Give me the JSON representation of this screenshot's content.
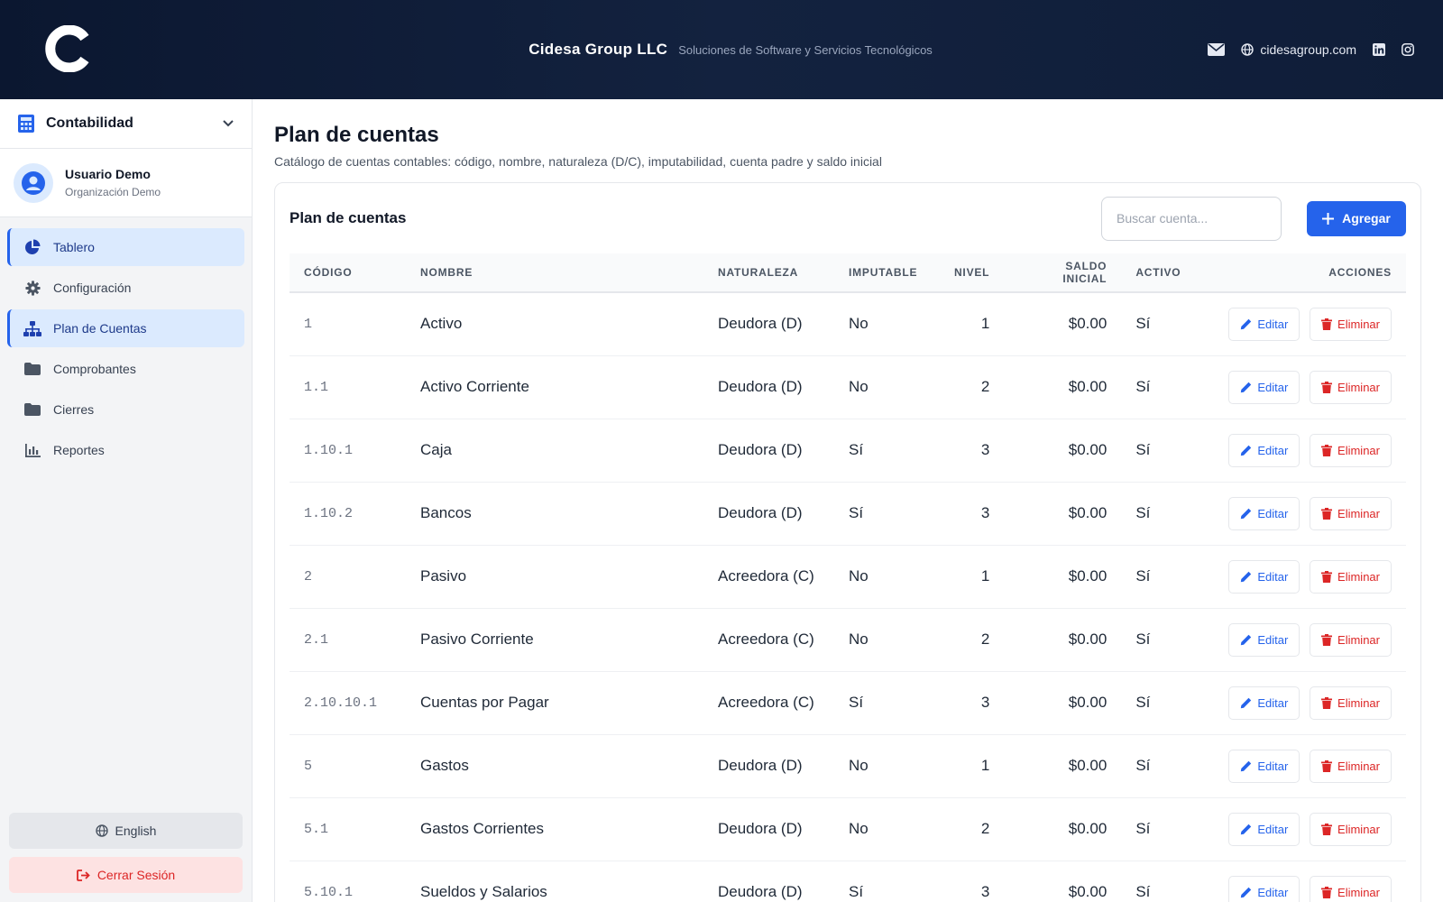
{
  "header": {
    "company": "Cidesa Group LLC",
    "tagline": "Soluciones de Software y Servicios Tecnológicos",
    "website": "cidesagroup.com",
    "colors": {
      "bg": "#0f1d38",
      "text": "#ffffff"
    }
  },
  "sidebar": {
    "module": "Contabilidad",
    "user": {
      "name": "Usuario Demo",
      "org": "Organización Demo"
    },
    "items": [
      {
        "label": "Tablero",
        "icon": "pie-chart-icon",
        "active": true
      },
      {
        "label": "Configuración",
        "icon": "gear-icon",
        "active": false
      },
      {
        "label": "Plan de Cuentas",
        "icon": "sitemap-icon",
        "active": true
      },
      {
        "label": "Comprobantes",
        "icon": "folder-icon",
        "active": false
      },
      {
        "label": "Cierres",
        "icon": "folder-icon",
        "active": false
      },
      {
        "label": "Reportes",
        "icon": "bar-chart-icon",
        "active": false
      }
    ],
    "language_label": "English",
    "logout_label": "Cerrar Sesión"
  },
  "main": {
    "title": "Plan de cuentas",
    "description": "Catálogo de cuentas contables: código, nombre, naturaleza (D/C), imputabilidad, cuenta padre y saldo inicial",
    "card_title": "Plan de cuentas",
    "search_placeholder": "Buscar cuenta...",
    "add_label": "Agregar",
    "edit_label": "Editar",
    "delete_label": "Eliminar",
    "columns": [
      "CÓDIGO",
      "NOMBRE",
      "NATURALEZA",
      "IMPUTABLE",
      "NIVEL",
      "SALDO INICIAL",
      "ACTIVO",
      "ACCIONES"
    ],
    "rows": [
      {
        "code": "1",
        "name": "Activo",
        "nature": "Deudora (D)",
        "imputable": "No",
        "level": "1",
        "balance": "$0.00",
        "active": "Sí"
      },
      {
        "code": "1.1",
        "name": "Activo Corriente",
        "nature": "Deudora (D)",
        "imputable": "No",
        "level": "2",
        "balance": "$0.00",
        "active": "Sí"
      },
      {
        "code": "1.10.1",
        "name": "Caja",
        "nature": "Deudora (D)",
        "imputable": "Sí",
        "level": "3",
        "balance": "$0.00",
        "active": "Sí"
      },
      {
        "code": "1.10.2",
        "name": "Bancos",
        "nature": "Deudora (D)",
        "imputable": "Sí",
        "level": "3",
        "balance": "$0.00",
        "active": "Sí"
      },
      {
        "code": "2",
        "name": "Pasivo",
        "nature": "Acreedora (C)",
        "imputable": "No",
        "level": "1",
        "balance": "$0.00",
        "active": "Sí"
      },
      {
        "code": "2.1",
        "name": "Pasivo Corriente",
        "nature": "Acreedora (C)",
        "imputable": "No",
        "level": "2",
        "balance": "$0.00",
        "active": "Sí"
      },
      {
        "code": "2.10.10.1",
        "name": "Cuentas por Pagar",
        "nature": "Acreedora (C)",
        "imputable": "Sí",
        "level": "3",
        "balance": "$0.00",
        "active": "Sí"
      },
      {
        "code": "5",
        "name": "Gastos",
        "nature": "Deudora (D)",
        "imputable": "No",
        "level": "1",
        "balance": "$0.00",
        "active": "Sí"
      },
      {
        "code": "5.1",
        "name": "Gastos Corrientes",
        "nature": "Deudora (D)",
        "imputable": "No",
        "level": "2",
        "balance": "$0.00",
        "active": "Sí"
      },
      {
        "code": "5.10.1",
        "name": "Sueldos y Salarios",
        "nature": "Deudora (D)",
        "imputable": "Sí",
        "level": "3",
        "balance": "$0.00",
        "active": "Sí"
      }
    ],
    "colors": {
      "primary": "#2563eb",
      "danger": "#dc2626",
      "active_nav": "#dbeafe"
    }
  }
}
